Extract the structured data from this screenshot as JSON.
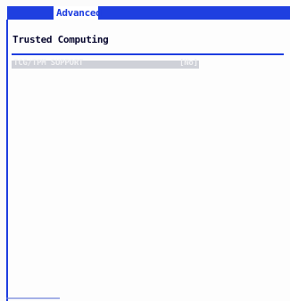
{
  "menu": {
    "active_tab": "Advanced"
  },
  "page": {
    "title": "Trusted Computing"
  },
  "settings": [
    {
      "label": "TCG/TPM SUPPORT",
      "value": "[No]"
    }
  ],
  "colors": {
    "menu_bar": "#1f3fe0",
    "background": "#fbfbfb",
    "highlight_row": "#cfd1d8"
  }
}
